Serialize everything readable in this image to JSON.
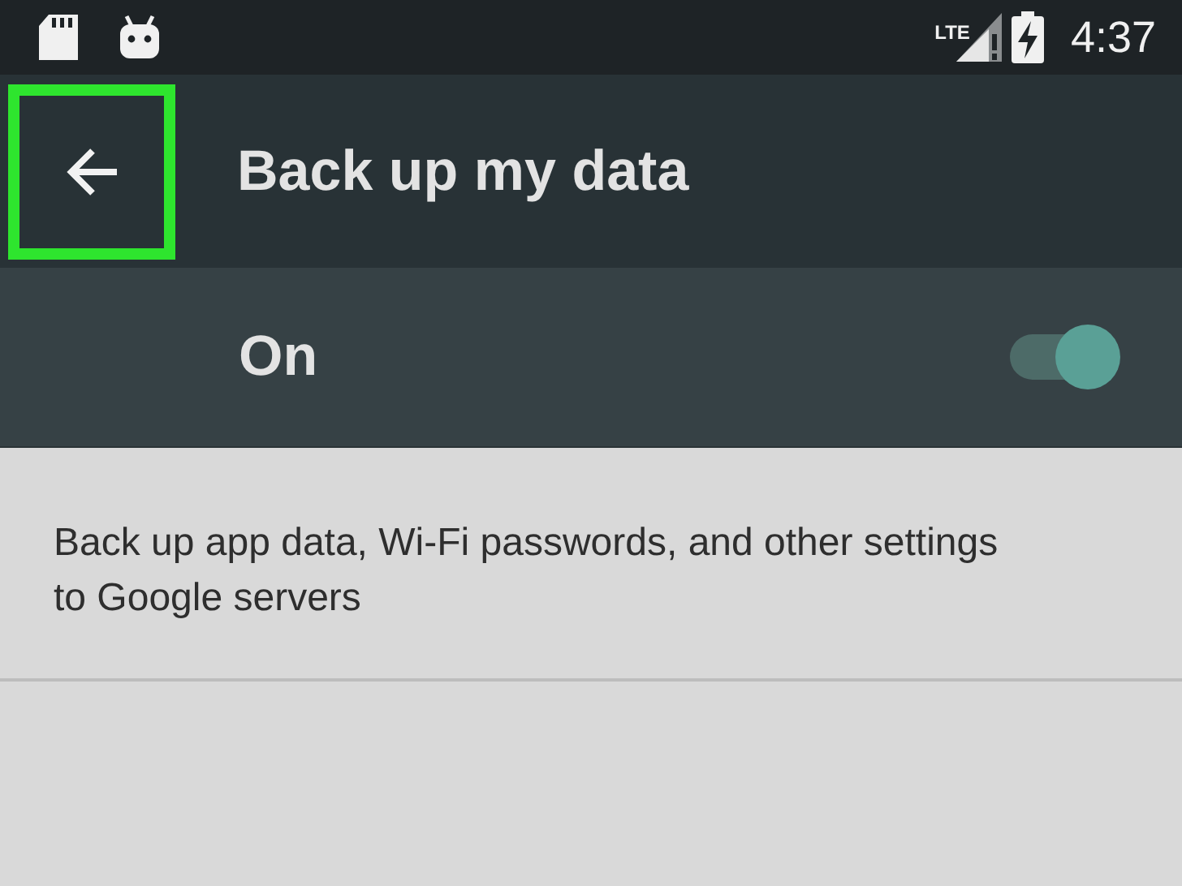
{
  "status_bar": {
    "network": "LTE",
    "time": "4:37"
  },
  "toolbar": {
    "back_highlighted": true,
    "title": "Back up my data"
  },
  "switch_row": {
    "label": "On",
    "on": true
  },
  "description": "Back up app data, Wi-Fi passwords, and other settings to Google servers"
}
